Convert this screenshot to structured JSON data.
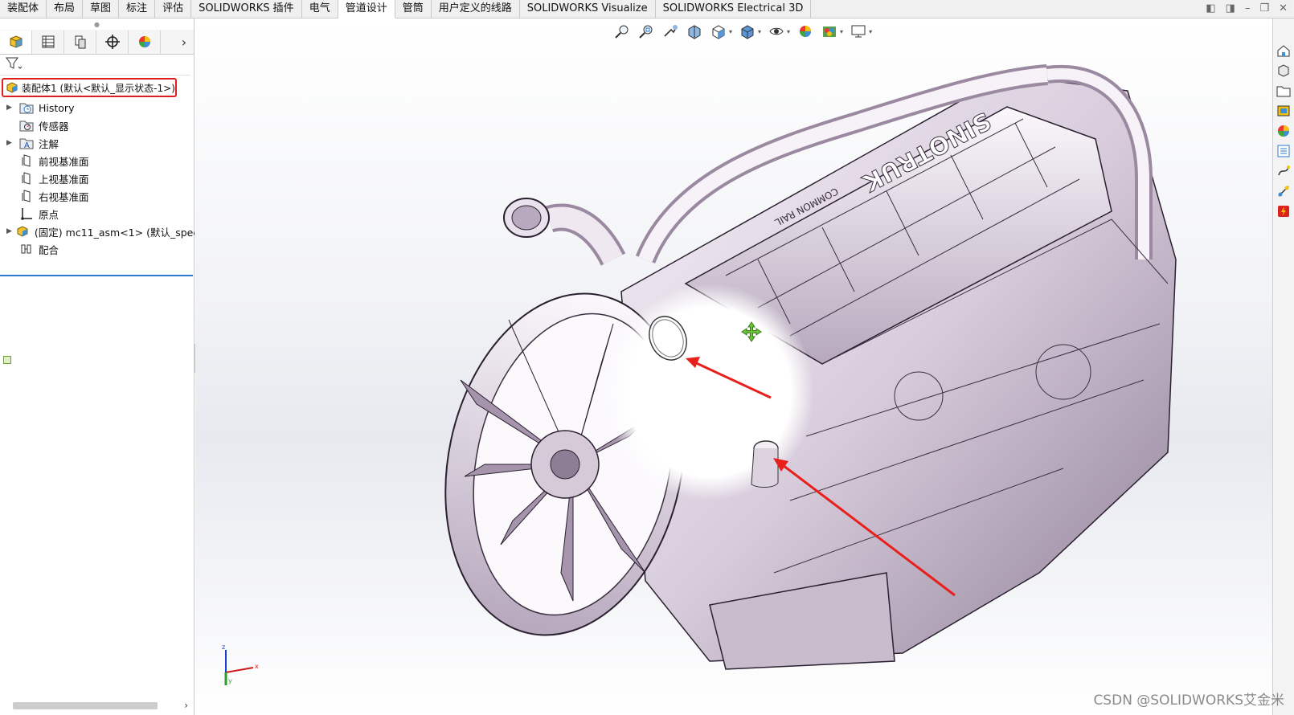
{
  "tabs": [
    {
      "label": "装配体",
      "active": false
    },
    {
      "label": "布局",
      "active": false
    },
    {
      "label": "草图",
      "active": false
    },
    {
      "label": "标注",
      "active": false
    },
    {
      "label": "评估",
      "active": false
    },
    {
      "label": "SOLIDWORKS 插件",
      "active": false
    },
    {
      "label": "电气",
      "active": false
    },
    {
      "label": "管道设计",
      "active": true
    },
    {
      "label": "管筒",
      "active": false
    },
    {
      "label": "用户定义的线路",
      "active": false
    },
    {
      "label": "SOLIDWORKS Visualize",
      "active": false
    },
    {
      "label": "SOLIDWORKS Electrical 3D",
      "active": false
    }
  ],
  "feature_manager": {
    "tabs": [
      "feature-manager-icon",
      "property-manager-icon",
      "configuration-manager-icon",
      "dimxpert-icon",
      "display-manager-icon"
    ],
    "root": {
      "label": "装配体1  (默认<默认_显示状态-1>)",
      "icon": "assembly-icon"
    },
    "items": [
      {
        "label": "History",
        "icon": "history-folder-icon",
        "expandable": true
      },
      {
        "label": "传感器",
        "icon": "sensor-icon",
        "expandable": false
      },
      {
        "label": "注解",
        "icon": "annotation-icon",
        "expandable": true
      },
      {
        "label": "前视基准面",
        "icon": "plane-icon",
        "expandable": false
      },
      {
        "label": "上视基准面",
        "icon": "plane-icon",
        "expandable": false
      },
      {
        "label": "右视基准面",
        "icon": "plane-icon",
        "expandable": false
      },
      {
        "label": "原点",
        "icon": "origin-icon",
        "expandable": false
      },
      {
        "label": "(固定) mc11_asm<1> (默认_speec",
        "icon": "part-icon",
        "expandable": true
      },
      {
        "label": "配合",
        "icon": "mates-icon",
        "expandable": false
      }
    ]
  },
  "viewport": {
    "headsup_icons": [
      "zoom-to-fit-icon",
      "zoom-area-icon",
      "previous-view-icon",
      "section-view-icon",
      "view-orientation-icon",
      "display-style-icon",
      "hide-show-items-icon",
      "edit-appearance-icon",
      "apply-scene-icon",
      "view-settings-icon"
    ],
    "brand_text": "SINOTRUK",
    "brand_subtext": "COMMON RAIL",
    "triad": {
      "x": "x",
      "y": "y",
      "z": "z"
    }
  },
  "task_pane_icons": [
    "home-icon",
    "resources-icon",
    "design-library-icon",
    "file-explorer-icon",
    "appearances-icon",
    "custom-properties-icon",
    "routing-library-icon",
    "routing-components-icon",
    "solidworks-electrical-icon"
  ],
  "watermark": "CSDN @SOLIDWORKS艾金米",
  "colors": {
    "accent": "#2b7bd1",
    "highlight_border": "#e02020",
    "arrow": "#e8201c",
    "move_cursor": "#6cc23a"
  }
}
